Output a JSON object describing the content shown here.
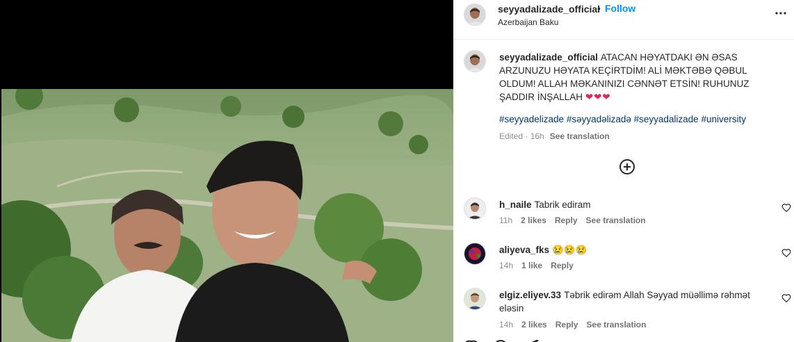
{
  "post": {
    "username": "seyyadalizade_official",
    "separator": "•",
    "follow_label": "Follow",
    "location": "Azerbaijan Baku",
    "more_icon": "more-horizontal-icon"
  },
  "caption": {
    "username": "seyyadalizade_official",
    "text": "ATACAN HƏYATDAKI ƏN ƏSAS ARZUNUZU HƏYATA KEÇİRTDİM! ALİ MƏKTƏBƏ QƏBUL OLDUM! ALLAH MƏKANINIZI CƏNNƏT ETSİN! RUHUNUZ ŞADDIR İNŞALLAH",
    "hearts": "❤❤❤",
    "hashtags": "#seyyadelizade #səyyadəlizadə #seyyadalizade #university",
    "edited": "Edited · 16h",
    "see_translation": "See translation"
  },
  "load_more_icon": "plus-circle-icon",
  "comments": [
    {
      "username": "h_naile",
      "text": "Tabrik ediram",
      "time": "11h",
      "likes": "2 likes",
      "reply": "Reply",
      "see_translation": "See translation"
    },
    {
      "username": "aliyeva_fks",
      "text": "😢😢😢",
      "time": "14h",
      "likes": "1 like",
      "reply": "Reply",
      "see_translation": ""
    },
    {
      "username": "elgiz.eliyev.33",
      "text": "Təbrik edirəm Allah Səyyad müəllimə rəhmət eləsin",
      "time": "14h",
      "likes": "2 likes",
      "reply": "Reply",
      "see_translation": "See translation"
    }
  ],
  "colors": {
    "accent": "#0095f6",
    "hashtag": "#00376b",
    "heart": "#e0245e",
    "meta": "#8e8e8e"
  }
}
